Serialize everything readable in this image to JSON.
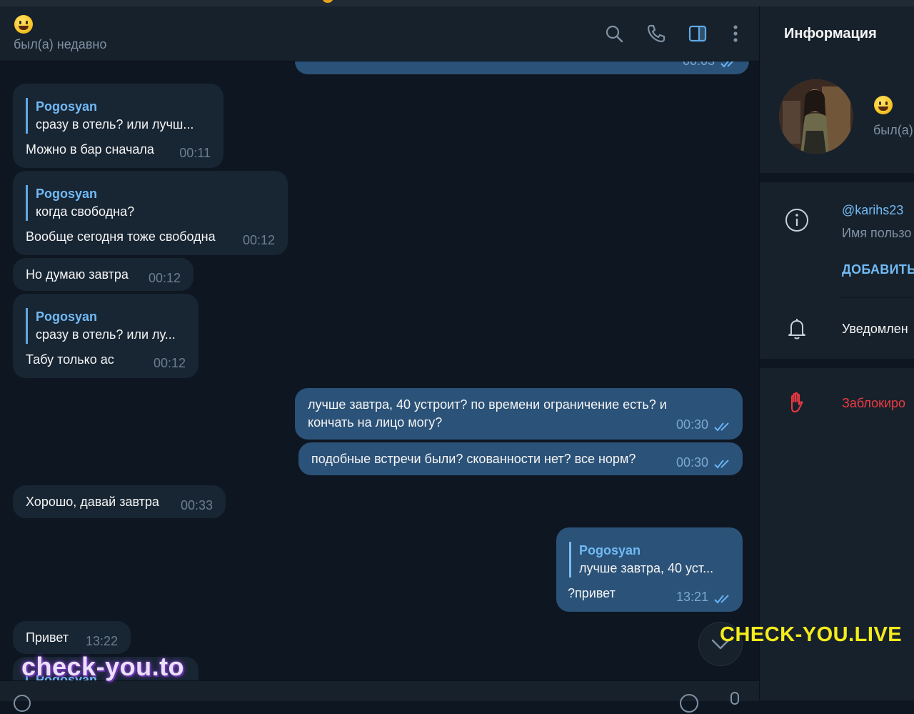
{
  "chat": {
    "status": "был(а) недавно"
  },
  "header_icons": [
    "search-icon",
    "phone-icon",
    "sidebar-toggle-icon",
    "more-vertical-icon"
  ],
  "messages": [
    {
      "dir": "out",
      "text": "",
      "time": "00:03",
      "partial": true
    },
    {
      "dir": "in",
      "reply_name": "Pogosyan",
      "reply_text": "сразу в отель? или лучш...",
      "text": "Можно в бар сначала",
      "time": "00:11"
    },
    {
      "dir": "in",
      "reply_name": "Pogosyan",
      "reply_text": "когда свободна?",
      "text": "Вообще сегодня тоже свободна",
      "time": "00:12"
    },
    {
      "dir": "in",
      "text": "Но думаю завтра",
      "time": "00:12"
    },
    {
      "dir": "in",
      "reply_name": "Pogosyan",
      "reply_text": "сразу в отель? или лу...",
      "text": "Табу только ас",
      "time": "00:12"
    },
    {
      "dir": "out",
      "text_line1": "лучше завтра, 40 устроит? по времени ограничение есть? и",
      "text_line2": "кончать на лицо могу?",
      "time": "00:30"
    },
    {
      "dir": "out",
      "text": "подобные встречи были? скованности нет? все норм?",
      "time": "00:30"
    },
    {
      "dir": "in",
      "text": "Хорошо, давай завтра",
      "time": "00:33"
    },
    {
      "dir": "out",
      "reply_name": "Pogosyan",
      "reply_text": "лучше завтра, 40 уст...",
      "text": "?привет",
      "time": "13:21"
    },
    {
      "dir": "in",
      "text": "Привет",
      "time": "13:22"
    },
    {
      "dir": "in",
      "reply_name": "Pogosyan",
      "partial": true
    }
  ],
  "info_panel": {
    "title": "Информация",
    "status": "был(а)",
    "username": "@karihs23",
    "username_caption": "Имя пользо",
    "add_button": "ДОБАВИТЬ",
    "notifications": "Уведомлен",
    "block": "Заблокиро"
  },
  "watermarks": {
    "right": "CHECK-YOU.LIVE",
    "left": "check-you.to"
  },
  "colors": {
    "background": "#0e1621",
    "panel": "#17212b",
    "incoming_bubble": "#182533",
    "outgoing_bubble": "#2b5278",
    "link": "#71baf5",
    "danger": "#ec3942"
  }
}
